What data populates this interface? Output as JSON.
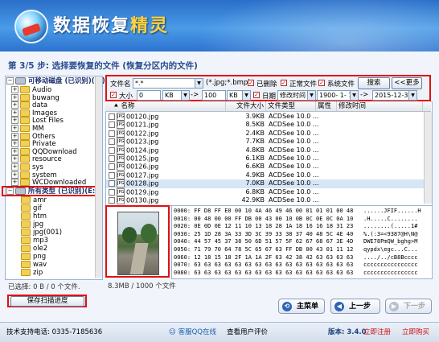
{
  "app": {
    "title_main": "数据恢复",
    "title_accent": "精灵"
  },
  "step_title": "第 3/5 步: 选择要恢复的文件 (恢复分区内的文件)",
  "tree": {
    "removable_disk": "可移动磁盘 (已识别)(E:)",
    "folders": [
      "Audio",
      "buwang",
      "data",
      "Images",
      "Lost Files",
      "MM",
      "Others",
      "Private",
      "QQDownload",
      "resource",
      "sys",
      "system",
      "WCDownloaded"
    ],
    "all_types": "所有类型 (已识别)(E:)",
    "types": [
      "amr",
      "gif",
      "htm",
      "jpg",
      "jpg(001)",
      "mp3",
      "ole2",
      "png",
      "wav",
      "zip"
    ]
  },
  "selected_status": "已选择: 0 B / 0 个文件.",
  "filter": {
    "filename_label": "文件名",
    "filename_value": "*.*",
    "filename_hint": "(*.jpg;*.bmp)",
    "deleted_label": "已删除",
    "normal_label": "正常文件",
    "system_label": "系统文件",
    "search_btn": "搜索",
    "more_btn": "<<更多",
    "size_label": "大小",
    "size_min": "0",
    "size_min_unit": "KB",
    "size_to": "->",
    "size_max": "100",
    "size_max_unit": "KB",
    "date_label": "日期",
    "date_field": "修改时间",
    "date_from": "1900- 1- 1",
    "date_arrow": "->",
    "date_to": "2015-12-31"
  },
  "columns": {
    "name": "名称",
    "size": "文件大小",
    "type": "文件类型",
    "attr": "属性",
    "mtime": "修改时间"
  },
  "files": [
    {
      "name": "00120.jpg",
      "size": "3.9KB",
      "type": "ACDSee 10.0 ..."
    },
    {
      "name": "00121.jpg",
      "size": "8.5KB",
      "type": "ACDSee 10.0 ..."
    },
    {
      "name": "00122.jpg",
      "size": "2.4KB",
      "type": "ACDSee 10.0 ..."
    },
    {
      "name": "00123.jpg",
      "size": "7.7KB",
      "type": "ACDSee 10.0 ..."
    },
    {
      "name": "00124.jpg",
      "size": "4.8KB",
      "type": "ACDSee 10.0 ..."
    },
    {
      "name": "00125.jpg",
      "size": "6.1KB",
      "type": "ACDSee 10.0 ..."
    },
    {
      "name": "00126.jpg",
      "size": "6.6KB",
      "type": "ACDSee 10.0 ..."
    },
    {
      "name": "00127.jpg",
      "size": "4.9KB",
      "type": "ACDSee 10.0 ..."
    },
    {
      "name": "00128.jpg",
      "size": "7.0KB",
      "type": "ACDSee 10.0 ..."
    },
    {
      "name": "00129.jpg",
      "size": "6.8KB",
      "type": "ACDSee 10.0 ..."
    },
    {
      "name": "00130.jpg",
      "size": "42.9KB",
      "type": "ACDSee 10.0 ..."
    }
  ],
  "hex_lines": [
    "0000: FF D8 FF E0 00 10 4A 46 49 46 00 01 01 01 00 48   ......JFIF......H",
    "0010: 00 48 00 00 FF DB 00 43 00 10 0B 0C 0E 0C 0A 10   .H.....C........",
    "0020: 0E 0D 0E 12 11 10 13 18 28 1A 18 16 16 18 31 23   ........(.....1#",
    "0030: 25 1D 28 3A 33 3D 3C 39 33 38 37 40 48 5C 4E 40   %.(:3=<9387@H\\N@",
    "0040: 44 57 45 37 38 50 6D 51 57 5F 62 67 68 67 3E 4D   DWE78PmQW_bghg>M",
    "0050: 71 79 70 64 78 5C 65 67 63 FF DB 00 43 01 11 12   qypdx\\egc...C...",
    "0060: 12 18 15 18 2F 1A 1A 2F 63 42 38 42 63 63 63 63   ..../../cB8Bcccc",
    "0070: 63 63 63 63 63 63 63 63 63 63 63 63 63 63 63 63   cccccccccccccccc",
    "0080: 63 63 63 63 63 63 63 63 63 63 63 63 63 63 63 63   cccccccccccccccc"
  ],
  "summary": "8.3MB / 1000 个文件",
  "save_btn": "保存扫描进度",
  "nav": {
    "main_menu": "主菜单",
    "prev": "上一步",
    "next": "下一步"
  },
  "footer": {
    "support": "技术支持电话: 0335-7185636",
    "qq": "客服QQ在线",
    "reviews": "查看用户评价",
    "version": "版本: 3.4.0",
    "register": "立即注册",
    "buy": "立即购买"
  }
}
